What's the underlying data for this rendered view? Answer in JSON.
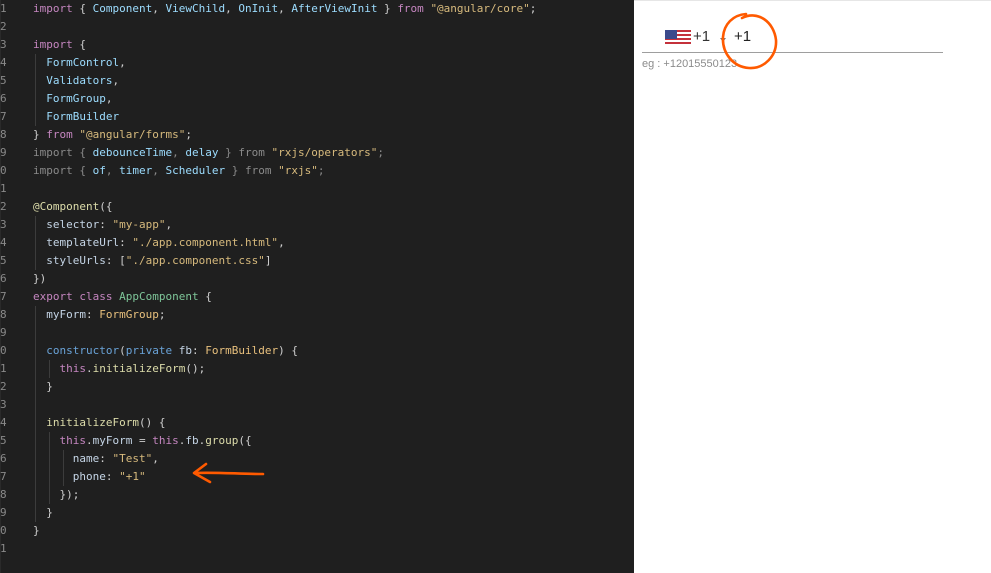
{
  "editor": {
    "lines": [
      {
        "n": "1",
        "tokens": [
          [
            "k",
            "import"
          ],
          [
            "p",
            " { "
          ],
          [
            "i",
            "Component"
          ],
          [
            "p",
            ", "
          ],
          [
            "i",
            "ViewChild"
          ],
          [
            "p",
            ", "
          ],
          [
            "i",
            "OnInit"
          ],
          [
            "p",
            ", "
          ],
          [
            "i",
            "AfterViewInit"
          ],
          [
            "p",
            " } "
          ],
          [
            "k",
            "from"
          ],
          [
            "p",
            " "
          ],
          [
            "s",
            "\"@angular/core\""
          ],
          [
            "p",
            ";"
          ]
        ]
      },
      {
        "n": "2",
        "tokens": []
      },
      {
        "n": "3",
        "tokens": [
          [
            "k",
            "import"
          ],
          [
            "p",
            " {"
          ]
        ]
      },
      {
        "n": "4",
        "tokens": [
          [
            "p",
            "  "
          ],
          [
            "i",
            "FormControl"
          ],
          [
            "p",
            ","
          ]
        ]
      },
      {
        "n": "5",
        "tokens": [
          [
            "p",
            "  "
          ],
          [
            "i",
            "Validators"
          ],
          [
            "p",
            ","
          ]
        ]
      },
      {
        "n": "6",
        "tokens": [
          [
            "p",
            "  "
          ],
          [
            "i",
            "FormGroup"
          ],
          [
            "p",
            ","
          ]
        ]
      },
      {
        "n": "7",
        "tokens": [
          [
            "p",
            "  "
          ],
          [
            "i",
            "FormBuilder"
          ]
        ]
      },
      {
        "n": "8",
        "tokens": [
          [
            "p",
            "} "
          ],
          [
            "k",
            "from"
          ],
          [
            "p",
            " "
          ],
          [
            "s",
            "\"@angular/forms\""
          ],
          [
            "p",
            ";"
          ]
        ]
      },
      {
        "n": "9",
        "tokens": [
          [
            "d",
            "import { "
          ],
          [
            "i",
            "debounceTime"
          ],
          [
            "d",
            ", "
          ],
          [
            "i",
            "delay"
          ],
          [
            "d",
            " } from "
          ],
          [
            "s",
            "\"rxjs/operators\""
          ],
          [
            "d",
            ";"
          ]
        ]
      },
      {
        "n": "0",
        "tokens": [
          [
            "d",
            "import { "
          ],
          [
            "i",
            "of"
          ],
          [
            "d",
            ", "
          ],
          [
            "i",
            "timer"
          ],
          [
            "d",
            ", "
          ],
          [
            "i",
            "Scheduler"
          ],
          [
            "d",
            " } from "
          ],
          [
            "s",
            "\"rxjs\""
          ],
          [
            "d",
            ";"
          ]
        ]
      },
      {
        "n": "1",
        "tokens": []
      },
      {
        "n": "2",
        "tokens": [
          [
            "f",
            "@Component"
          ],
          [
            "p",
            "({"
          ]
        ]
      },
      {
        "n": "3",
        "tokens": [
          [
            "p",
            "  "
          ],
          [
            "pr",
            "selector"
          ],
          [
            "p",
            ": "
          ],
          [
            "s",
            "\"my-app\""
          ],
          [
            "p",
            ","
          ]
        ]
      },
      {
        "n": "4",
        "tokens": [
          [
            "p",
            "  "
          ],
          [
            "pr",
            "templateUrl"
          ],
          [
            "p",
            ": "
          ],
          [
            "s",
            "\"./app.component.html\""
          ],
          [
            "p",
            ","
          ]
        ]
      },
      {
        "n": "5",
        "tokens": [
          [
            "p",
            "  "
          ],
          [
            "pr",
            "styleUrls"
          ],
          [
            "p",
            ": ["
          ],
          [
            "s",
            "\"./app.component.css\""
          ],
          [
            "p",
            "]"
          ]
        ]
      },
      {
        "n": "6",
        "tokens": [
          [
            "p",
            "})"
          ]
        ]
      },
      {
        "n": "7",
        "tokens": [
          [
            "k",
            "export"
          ],
          [
            "p",
            " "
          ],
          [
            "k",
            "class"
          ],
          [
            "p",
            " "
          ],
          [
            "c",
            "AppComponent"
          ],
          [
            "p",
            " {"
          ]
        ]
      },
      {
        "n": "8",
        "tokens": [
          [
            "p",
            "  "
          ],
          [
            "pr",
            "myForm"
          ],
          [
            "p",
            ": "
          ],
          [
            "t",
            "FormGroup"
          ],
          [
            "p",
            ";"
          ]
        ]
      },
      {
        "n": "9",
        "tokens": []
      },
      {
        "n": "0",
        "tokens": [
          [
            "p",
            "  "
          ],
          [
            "kb",
            "constructor"
          ],
          [
            "p",
            "("
          ],
          [
            "kb",
            "private"
          ],
          [
            "p",
            " "
          ],
          [
            "pr",
            "fb"
          ],
          [
            "p",
            ": "
          ],
          [
            "t",
            "FormBuilder"
          ],
          [
            "p",
            ") {"
          ]
        ]
      },
      {
        "n": "1",
        "tokens": [
          [
            "p",
            "    "
          ],
          [
            "k",
            "this"
          ],
          [
            "p",
            "."
          ],
          [
            "f",
            "initializeForm"
          ],
          [
            "p",
            "();"
          ]
        ]
      },
      {
        "n": "2",
        "tokens": [
          [
            "p",
            "  }"
          ]
        ]
      },
      {
        "n": "3",
        "tokens": []
      },
      {
        "n": "4",
        "tokens": [
          [
            "p",
            "  "
          ],
          [
            "f",
            "initializeForm"
          ],
          [
            "p",
            "() {"
          ]
        ]
      },
      {
        "n": "5",
        "tokens": [
          [
            "p",
            "    "
          ],
          [
            "k",
            "this"
          ],
          [
            "p",
            "."
          ],
          [
            "pr",
            "myForm"
          ],
          [
            "p",
            " = "
          ],
          [
            "k",
            "this"
          ],
          [
            "p",
            "."
          ],
          [
            "pr",
            "fb"
          ],
          [
            "p",
            "."
          ],
          [
            "f",
            "group"
          ],
          [
            "p",
            "({"
          ]
        ]
      },
      {
        "n": "6",
        "tokens": [
          [
            "p",
            "      "
          ],
          [
            "pr",
            "name"
          ],
          [
            "p",
            ": "
          ],
          [
            "s",
            "\"Test\""
          ],
          [
            "p",
            ","
          ]
        ]
      },
      {
        "n": "7",
        "tokens": [
          [
            "p",
            "      "
          ],
          [
            "pr",
            "phone"
          ],
          [
            "p",
            ": "
          ],
          [
            "s",
            "\"+1\""
          ]
        ]
      },
      {
        "n": "8",
        "tokens": [
          [
            "p",
            "    });"
          ]
        ]
      },
      {
        "n": "9",
        "tokens": [
          [
            "p",
            "  }"
          ]
        ]
      },
      {
        "n": "0",
        "tokens": [
          [
            "p",
            "}"
          ]
        ]
      },
      {
        "n": "1",
        "tokens": []
      }
    ]
  },
  "preview": {
    "country_code": "+1",
    "phone_value": "+1",
    "hint": "eg : +12015550123",
    "flag_icon": "us-flag-icon"
  },
  "colors": {
    "annotation": "#ff5a00",
    "editor_bg": "#1f1f1f"
  }
}
